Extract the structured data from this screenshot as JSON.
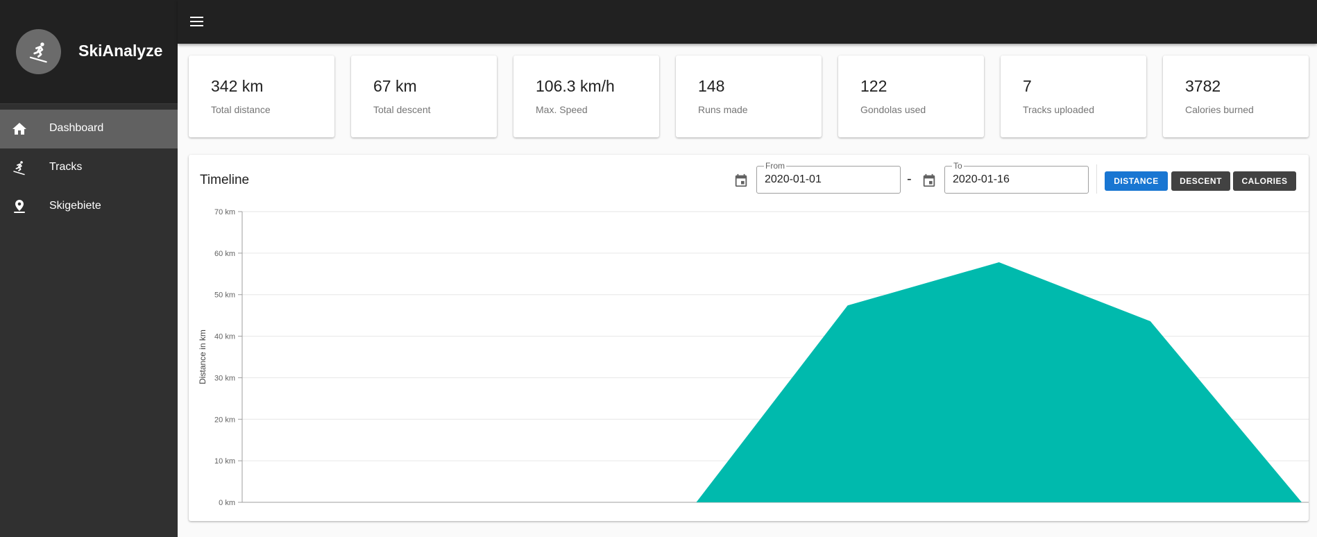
{
  "app": {
    "name": "SkiAnalyze",
    "logo_icon": "skier-icon"
  },
  "sidebar": {
    "items": [
      {
        "label": "Dashboard",
        "icon": "home-icon",
        "active": true
      },
      {
        "label": "Tracks",
        "icon": "skiing-icon",
        "active": false
      },
      {
        "label": "Skigebiete",
        "icon": "location-pin-icon",
        "active": false
      }
    ]
  },
  "topbar": {
    "menu_icon": "hamburger-menu-icon"
  },
  "stats": [
    {
      "value": "342 km",
      "label": "Total distance"
    },
    {
      "value": "67 km",
      "label": "Total descent"
    },
    {
      "value": "106.3 km/h",
      "label": "Max. Speed"
    },
    {
      "value": "148",
      "label": "Runs made"
    },
    {
      "value": "122",
      "label": "Gondolas used"
    },
    {
      "value": "7",
      "label": "Tracks uploaded"
    },
    {
      "value": "3782",
      "label": "Calories burned"
    }
  ],
  "timeline": {
    "title": "Timeline",
    "from_label": "From",
    "from_value": "2020-01-01",
    "separator": "-",
    "to_label": "To",
    "to_value": "2020-01-16",
    "buttons": {
      "distance": "Distance",
      "descent": "Descent",
      "calories": "Calories"
    },
    "active_metric": "distance"
  },
  "colors": {
    "area_fill": "#00baad",
    "active_button": "#1976d2",
    "inactive_button": "#424242",
    "sidebar": "#303030",
    "topbar": "#212121"
  },
  "chart_data": {
    "type": "area",
    "ylabel": "Distance in km",
    "y_ticks": [
      "0 km",
      "10 km",
      "20 km",
      "30 km",
      "40 km",
      "50 km",
      "60 km",
      "70 km"
    ],
    "ylim": [
      0,
      70
    ],
    "grid": true,
    "series": [
      {
        "values": [
          0,
          0,
          0,
          0,
          47.4,
          57.8,
          43.6,
          0
        ]
      }
    ]
  }
}
